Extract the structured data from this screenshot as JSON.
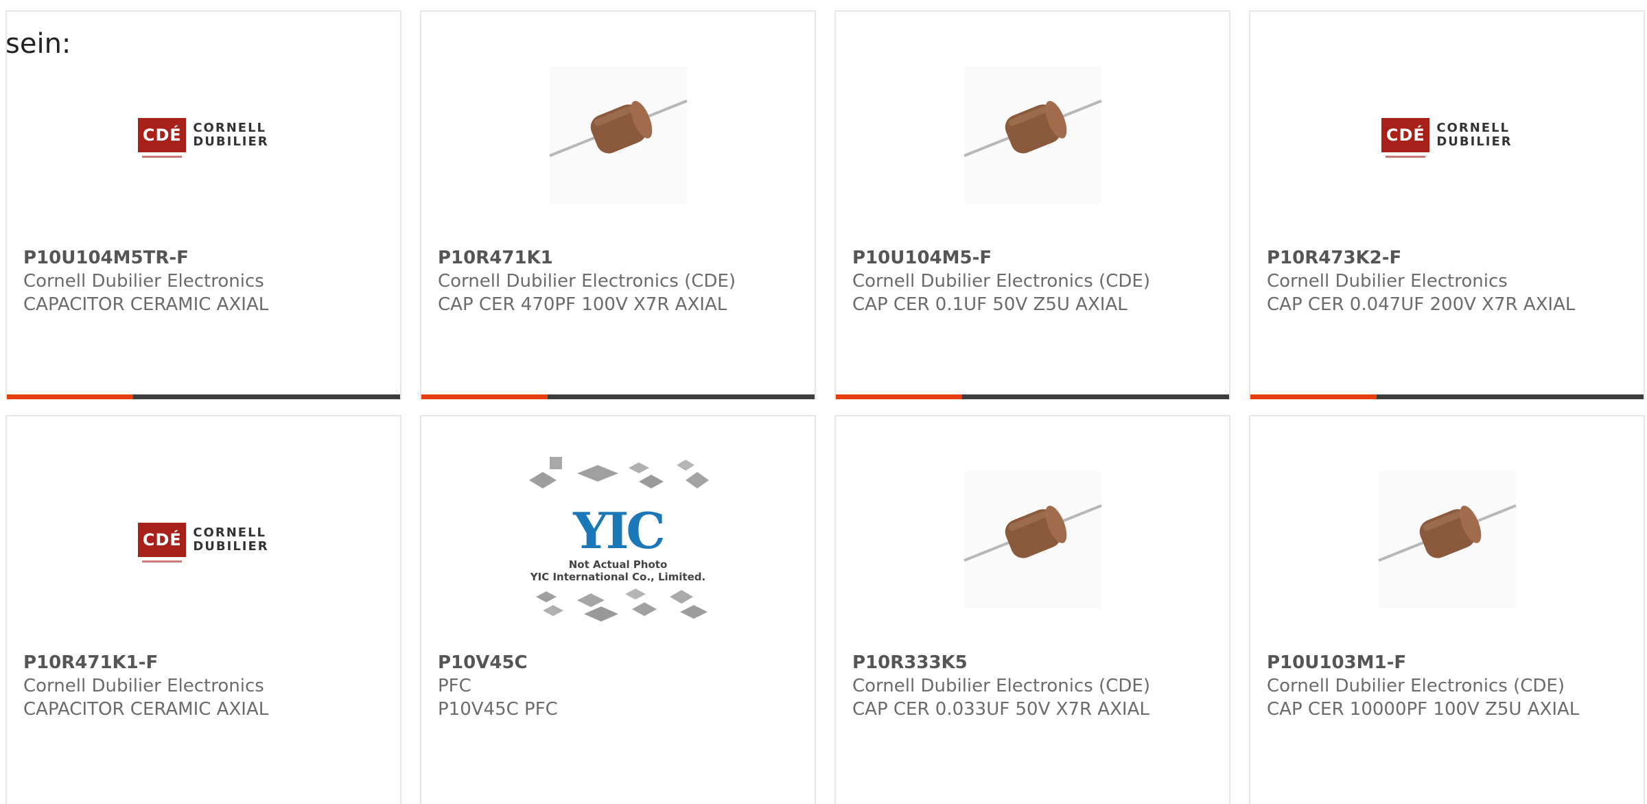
{
  "lead_text": "sein:",
  "colors": {
    "accent_bar": "#e8400c",
    "bar": "#3d3d3d",
    "capacitor_body": "#8b5a3c",
    "cde_red": "#a8201a"
  },
  "cards": [
    {
      "part_number": "P10U104M5TR-F",
      "manufacturer": "Cornell Dubilier Electronics",
      "description": "CAPACITOR CERAMIC AXIAL",
      "image": "cde-logo"
    },
    {
      "part_number": "P10R471K1",
      "manufacturer": "Cornell Dubilier Electronics (CDE)",
      "description": "CAP CER 470PF 100V X7R AXIAL",
      "image": "axial-capacitor"
    },
    {
      "part_number": "P10U104M5-F",
      "manufacturer": "Cornell Dubilier Electronics (CDE)",
      "description": "CAP CER 0.1UF 50V Z5U AXIAL",
      "image": "axial-capacitor"
    },
    {
      "part_number": "P10R473K2-F",
      "manufacturer": "Cornell Dubilier Electronics",
      "description": "CAP CER 0.047UF 200V X7R AXIAL",
      "image": "cde-logo"
    },
    {
      "part_number": "P10R471K1-F",
      "manufacturer": "Cornell Dubilier Electronics",
      "description": "CAPACITOR CERAMIC AXIAL",
      "image": "cde-logo"
    },
    {
      "part_number": "P10V45C",
      "manufacturer": "PFC",
      "description": "P10V45C PFC",
      "image": "yic-placeholder"
    },
    {
      "part_number": "P10R333K5",
      "manufacturer": "Cornell Dubilier Electronics (CDE)",
      "description": "CAP CER 0.033UF 50V X7R AXIAL",
      "image": "axial-capacitor"
    },
    {
      "part_number": "P10U103M1-F",
      "manufacturer": "Cornell Dubilier Electronics (CDE)",
      "description": "CAP CER 10000PF 100V Z5U AXIAL",
      "image": "axial-capacitor"
    }
  ],
  "cde_logo": {
    "box_text": "CDÉ",
    "line1": "CORNELL",
    "line2": "DUBILIER"
  },
  "yic": {
    "caption1": "Not Actual Photo",
    "caption2": "YIC International Co., Limited.",
    "mark": "YIC"
  }
}
